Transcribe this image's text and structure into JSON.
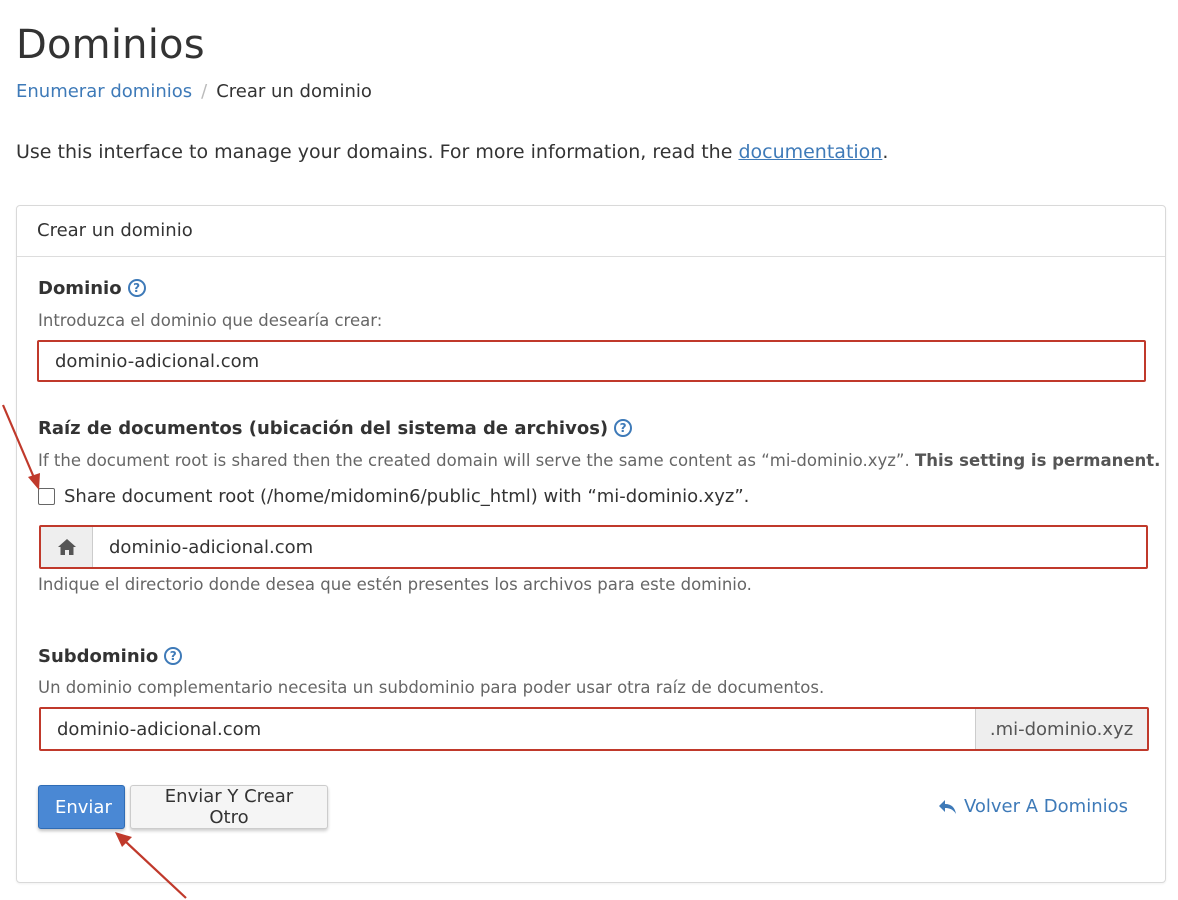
{
  "page": {
    "title": "Dominios",
    "breadcrumb": {
      "parent": "Enumerar dominios",
      "separator": "/",
      "current": "Crear un dominio"
    },
    "intro": {
      "before": "Use this interface to manage your domains. For more information, read the ",
      "link": "documentation",
      "after": "."
    }
  },
  "panel": {
    "heading": "Crear un dominio",
    "domain": {
      "label": "Dominio",
      "help": "Introduzca el dominio que desearía crear:",
      "value": "dominio-adicional.com"
    },
    "docroot": {
      "label": "Raíz de documentos (ubicación del sistema de archivos)",
      "help_before": "If the document root is shared then the created domain will serve the same content as “mi-dominio.xyz”. ",
      "help_bold": "This setting is permanent.",
      "checkbox_label": "Share document root (/home/midomin6/public_html) with “mi-dominio.xyz”.",
      "checked": false,
      "value": "dominio-adicional.com",
      "addon_icon": "home-icon",
      "hint": "Indique el directorio donde desea que estén presentes los archivos para este dominio."
    },
    "subdomain": {
      "label": "Subdominio",
      "help": "Un dominio complementario necesita un subdominio para poder usar otra raíz de documentos.",
      "value": "dominio-adicional.com",
      "suffix": ".mi-dominio.xyz"
    },
    "buttons": {
      "submit": "Enviar",
      "submit_another": "Enviar Y Crear Otro",
      "back": "Volver A Dominios"
    }
  },
  "colors": {
    "link": "#3e7ab8",
    "primary_button": "#4a88d4",
    "highlight_border": "#c0392b",
    "annotation_arrow": "#c0392b"
  }
}
